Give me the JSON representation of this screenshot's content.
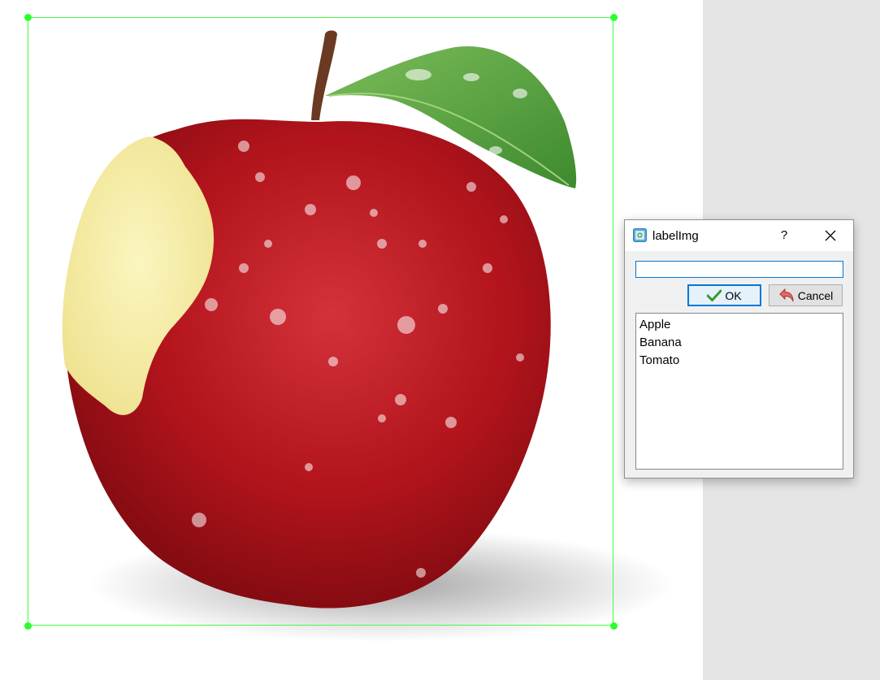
{
  "dialog": {
    "title": "labelImg",
    "help_label": "?",
    "input_value": "",
    "ok_label": "OK",
    "cancel_label": "Cancel",
    "labels": [
      "Apple",
      "Banana",
      "Tomato"
    ]
  },
  "colors": {
    "bbox": "#3fff3f",
    "accent": "#0078d7",
    "apple_red": "#b3141c",
    "gutter": "#e5e5e5"
  },
  "icons": {
    "app": "labelimg-app-icon",
    "ok": "checkmark-icon",
    "cancel": "undo-arrow-icon",
    "close": "close-icon"
  }
}
